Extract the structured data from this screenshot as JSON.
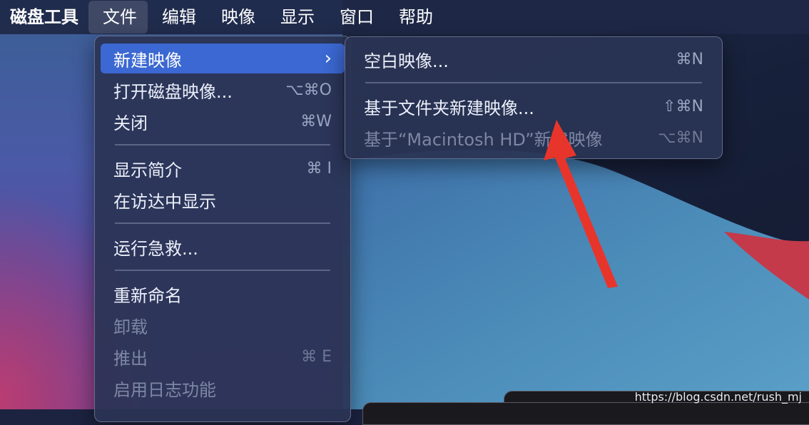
{
  "menubar": {
    "app_name": "磁盘工具",
    "items": [
      "文件",
      "编辑",
      "映像",
      "显示",
      "窗口",
      "帮助"
    ],
    "active_item": "文件"
  },
  "file_menu": {
    "items": [
      {
        "label": "新建映像",
        "shortcut": "",
        "submenu": true,
        "state": "highlighted"
      },
      {
        "label": "打开磁盘映像...",
        "shortcut": "⌥⌘O",
        "state": "enabled"
      },
      {
        "label": "关闭",
        "shortcut": "⌘W",
        "state": "enabled"
      },
      {
        "label": "显示简介",
        "shortcut": "⌘ I",
        "state": "enabled"
      },
      {
        "label": "在访达中显示",
        "shortcut": "",
        "state": "enabled"
      },
      {
        "label": "运行急救...",
        "shortcut": "",
        "state": "enabled"
      },
      {
        "label": "重新命名",
        "shortcut": "",
        "state": "enabled"
      },
      {
        "label": "卸载",
        "shortcut": "",
        "state": "disabled"
      },
      {
        "label": "推出",
        "shortcut": "⌘ E",
        "state": "disabled"
      },
      {
        "label": "启用日志功能",
        "shortcut": "",
        "state": "disabled"
      }
    ]
  },
  "new_image_submenu": {
    "items": [
      {
        "label": "空白映像...",
        "shortcut": "⌘N",
        "state": "enabled"
      },
      {
        "label": "基于文件夹新建映像...",
        "shortcut": "⇧⌘N",
        "state": "enabled"
      },
      {
        "label": "基于“Macintosh HD”新建映像",
        "shortcut": "⌥⌘N",
        "state": "disabled"
      }
    ]
  },
  "annotation": {
    "color": "#e8352b"
  },
  "watermark": "https://blog.csdn.net/rush_mj",
  "colors": {
    "highlight": "#3b68d2",
    "menu_bg": "#2a3454"
  }
}
